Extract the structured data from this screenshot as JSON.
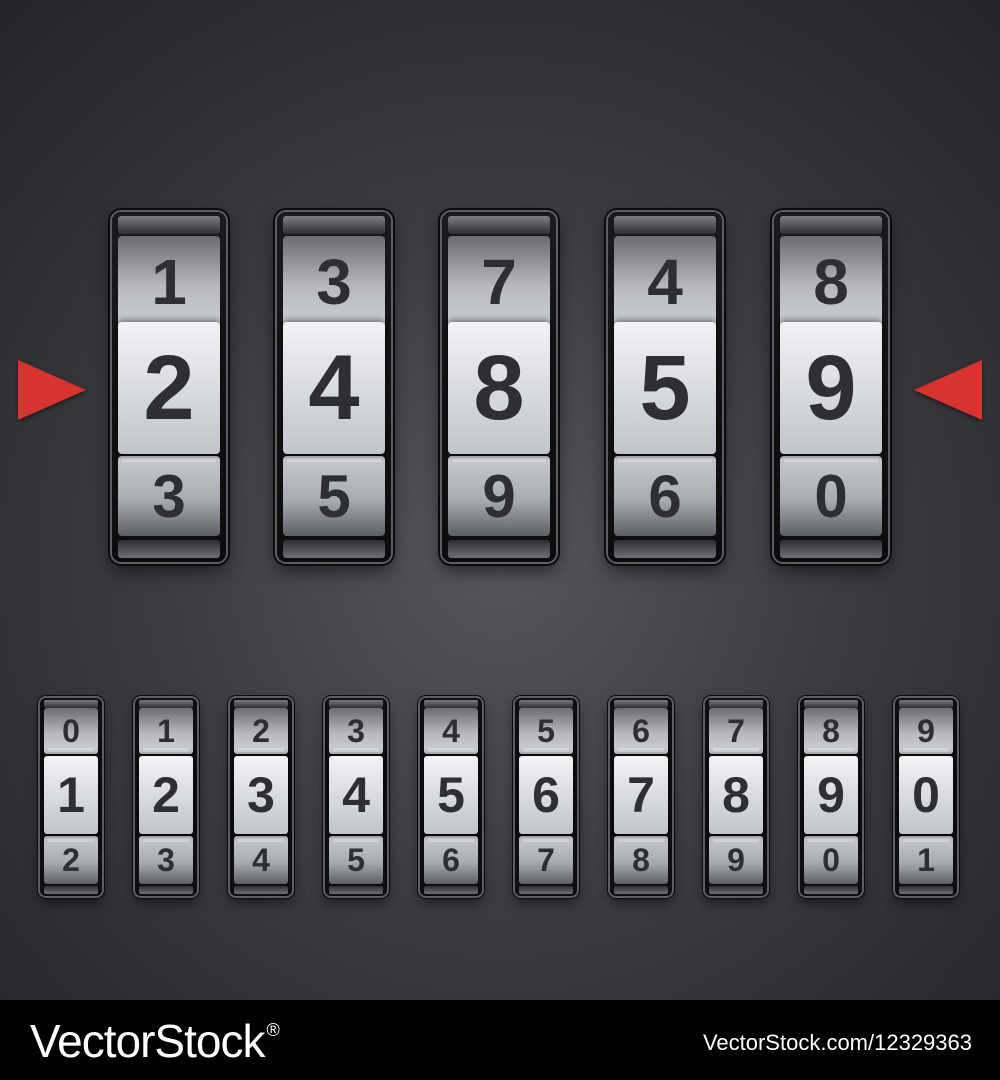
{
  "big_wheels": [
    {
      "top": "1",
      "mid": "2",
      "bot": "3"
    },
    {
      "top": "3",
      "mid": "4",
      "bot": "5"
    },
    {
      "top": "7",
      "mid": "8",
      "bot": "9"
    },
    {
      "top": "4",
      "mid": "5",
      "bot": "6"
    },
    {
      "top": "8",
      "mid": "9",
      "bot": "0"
    }
  ],
  "small_wheels": [
    {
      "top": "0",
      "mid": "1",
      "bot": "2"
    },
    {
      "top": "1",
      "mid": "2",
      "bot": "3"
    },
    {
      "top": "2",
      "mid": "3",
      "bot": "4"
    },
    {
      "top": "3",
      "mid": "4",
      "bot": "5"
    },
    {
      "top": "4",
      "mid": "5",
      "bot": "6"
    },
    {
      "top": "5",
      "mid": "6",
      "bot": "7"
    },
    {
      "top": "6",
      "mid": "7",
      "bot": "8"
    },
    {
      "top": "7",
      "mid": "8",
      "bot": "9"
    },
    {
      "top": "8",
      "mid": "9",
      "bot": "0"
    },
    {
      "top": "9",
      "mid": "0",
      "bot": "1"
    }
  ],
  "pointer_color": "#d7342f",
  "footer": {
    "brand": "VectorStock",
    "registered": "®",
    "image_id": "VectorStock.com/12329363"
  }
}
